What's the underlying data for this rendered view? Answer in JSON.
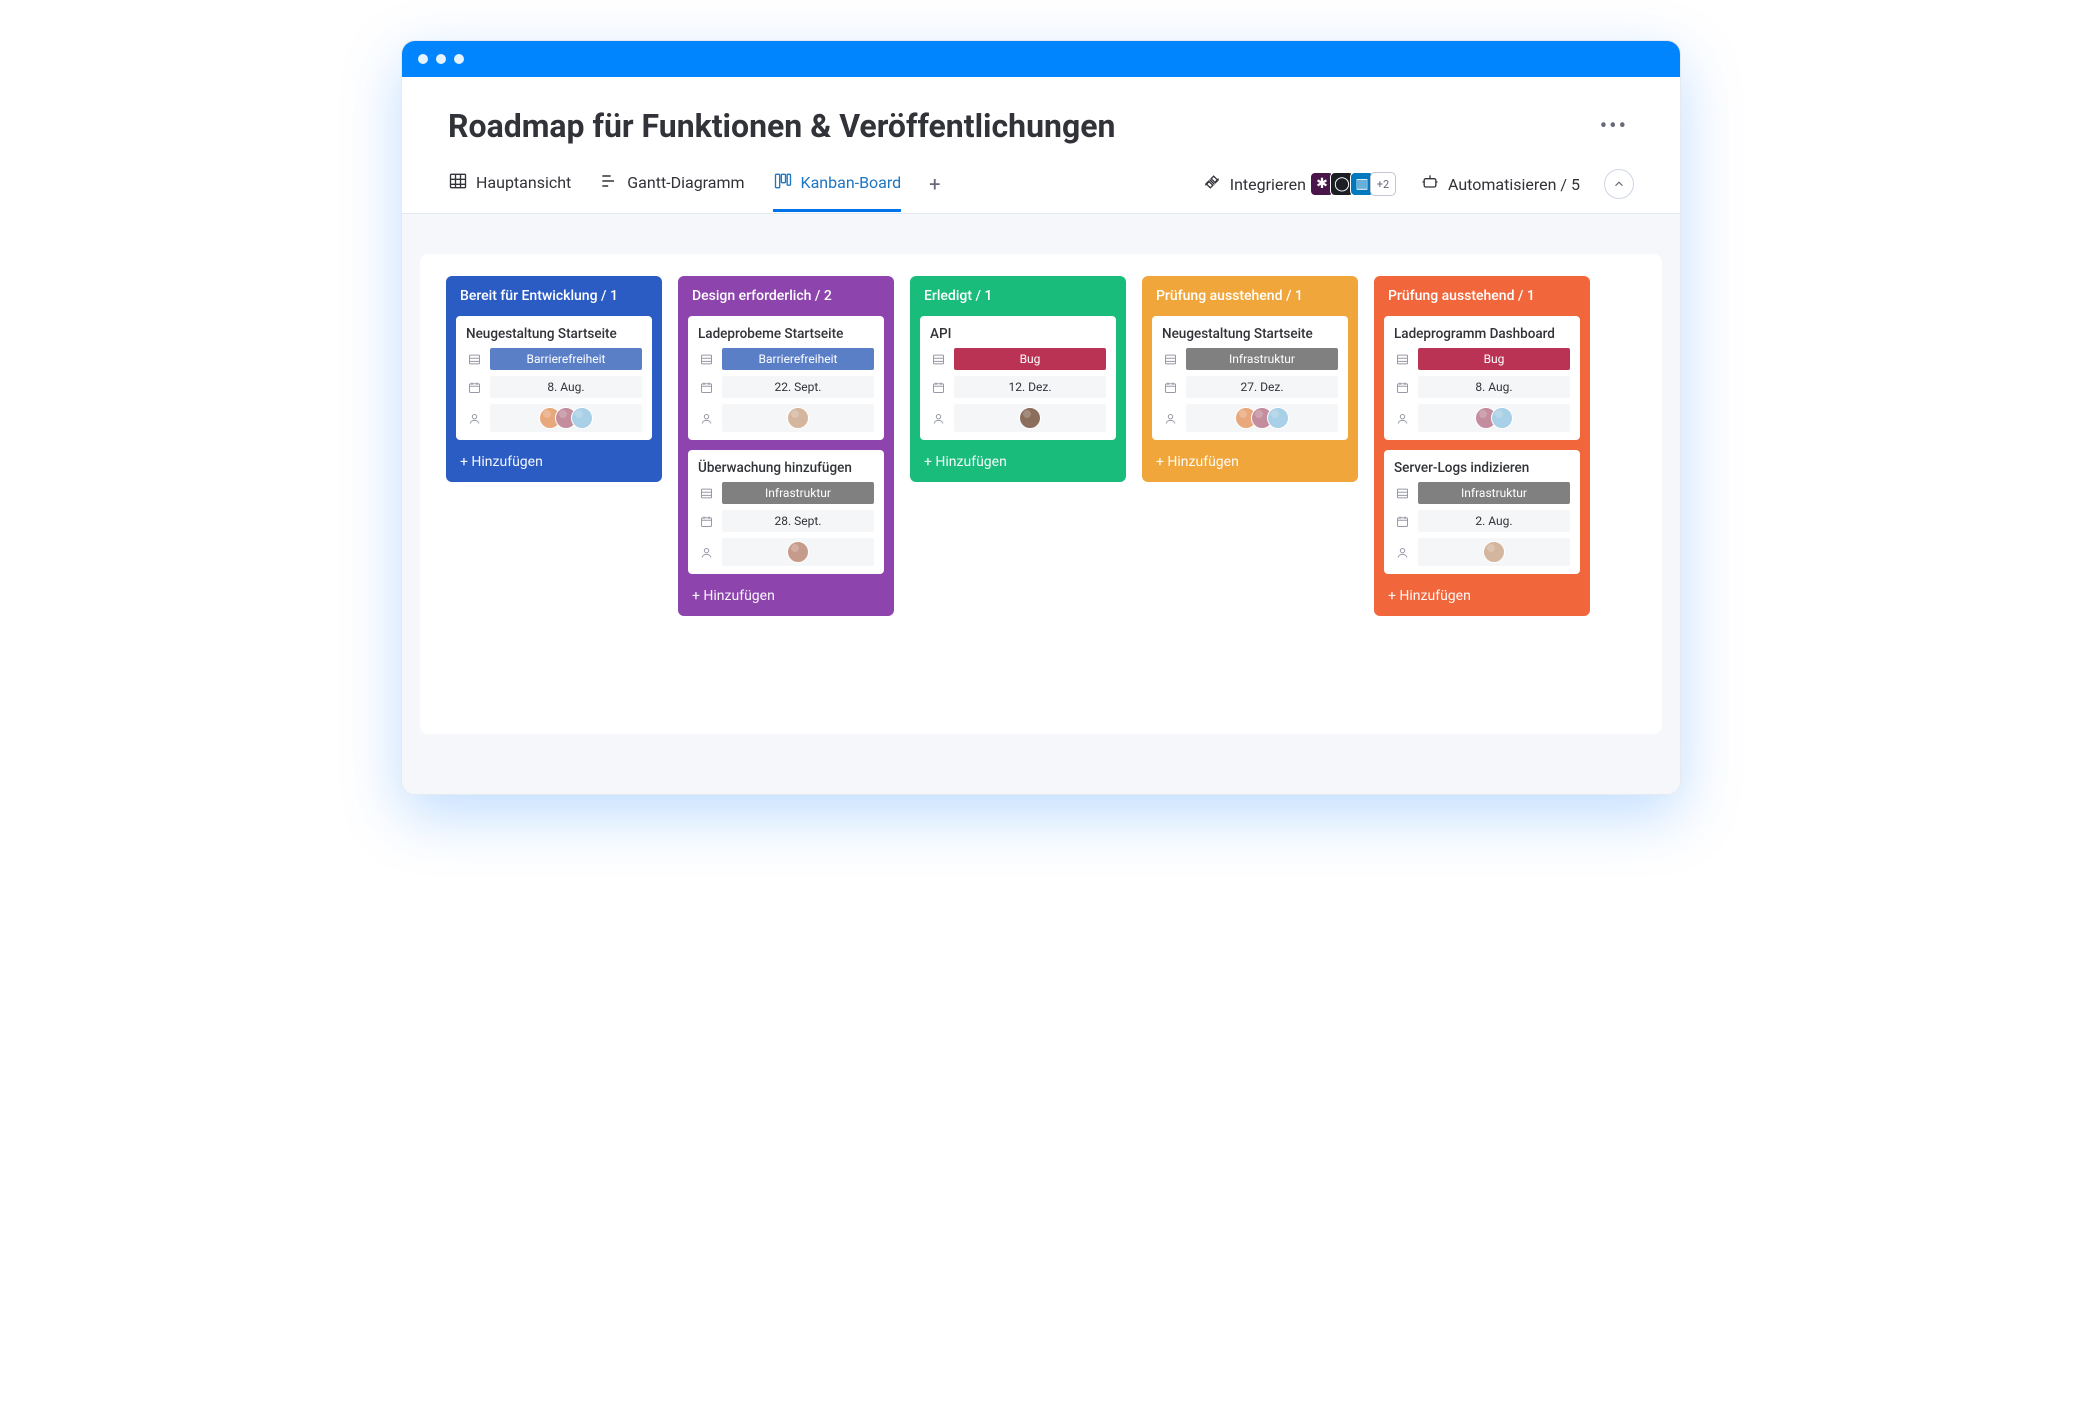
{
  "header": {
    "title": "Roadmap für Funktionen & Veröffentlichungen"
  },
  "tabs": {
    "main": "Hauptansicht",
    "gantt": "Gantt-Diagramm",
    "kanban": "Kanban-Board"
  },
  "toolbar": {
    "integrate": "Integrieren",
    "integrate_more": "+2",
    "automate": "Automatisieren / 5"
  },
  "add_label": "+ Hinzufügen",
  "tag_colors": {
    "accessibility": "#5b7fc7",
    "bug": "#bb3354",
    "infra": "#808080"
  },
  "columns": [
    {
      "color": "#2b5cc4",
      "title": "Bereit für Entwicklung / 1",
      "cards": [
        {
          "title": "Neugestaltung Startseite",
          "tag": "Barrierefreiheit",
          "tag_key": "accessibility",
          "date": "8. Aug.",
          "avatars": [
            "#e8a87c",
            "#c38d9e",
            "#a8d0e6"
          ]
        }
      ]
    },
    {
      "color": "#8e44ad",
      "title": "Design erforderlich / 2",
      "cards": [
        {
          "title": "Ladeprobeme Startseite",
          "tag": "Barrierefreiheit",
          "tag_key": "accessibility",
          "date": "22. Sept.",
          "avatars": [
            "#d4b59e"
          ]
        },
        {
          "title": "Überwachung hinzufügen",
          "tag": "Infrastruktur",
          "tag_key": "infra",
          "date": "28. Sept.",
          "avatars": [
            "#c79b8b"
          ]
        }
      ]
    },
    {
      "color": "#1abc7b",
      "title": "Erledigt / 1",
      "cards": [
        {
          "title": "API",
          "tag": "Bug",
          "tag_key": "bug",
          "date": "12. Dez.",
          "avatars": [
            "#8b6f5c"
          ]
        }
      ]
    },
    {
      "color": "#f0a63a",
      "title": "Prüfung ausstehend / 1",
      "cards": [
        {
          "title": "Neugestaltung Startseite",
          "tag": "Infrastruktur",
          "tag_key": "infra",
          "date": "27. Dez.",
          "avatars": [
            "#e8a87c",
            "#c38d9e",
            "#a8d0e6"
          ]
        }
      ]
    },
    {
      "color": "#f2663b",
      "title": "Prüfung ausstehend / 1",
      "cards": [
        {
          "title": "Ladeprogramm Dashboard",
          "tag": "Bug",
          "tag_key": "bug",
          "date": "8. Aug.",
          "avatars": [
            "#c38d9e",
            "#a8d0e6"
          ]
        },
        {
          "title": "Server-Logs indizieren",
          "tag": "Infrastruktur",
          "tag_key": "infra",
          "date": "2. Aug.",
          "avatars": [
            "#d4b59e"
          ]
        }
      ]
    }
  ]
}
